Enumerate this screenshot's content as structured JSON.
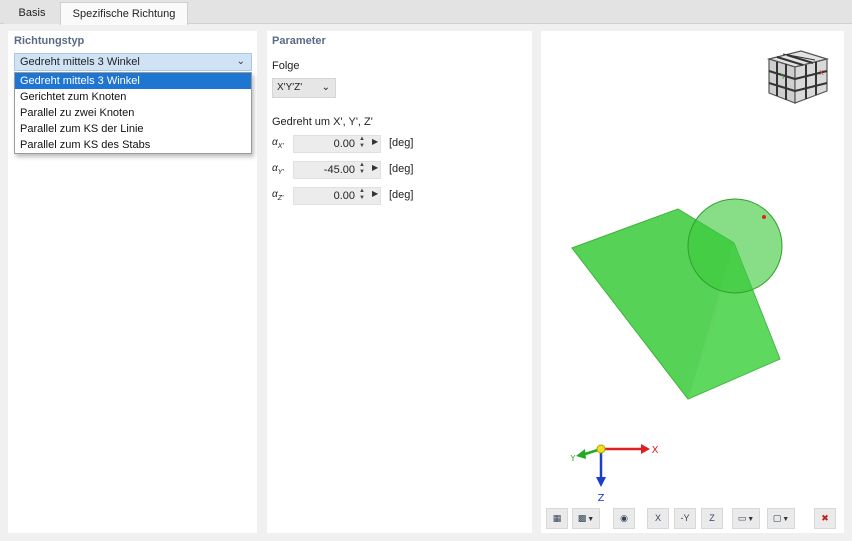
{
  "tabs": [
    {
      "label": "Basis"
    },
    {
      "label": "Spezifische Richtung"
    }
  ],
  "left_panel": {
    "title": "Richtungstyp",
    "selected": "Gedreht mittels 3 Winkel",
    "options": [
      "Gedreht mittels 3 Winkel",
      "Gerichtet zum Knoten",
      "Parallel zu zwei Knoten",
      "Parallel zum KS der Linie",
      "Parallel zum KS des Stabs"
    ]
  },
  "parameter": {
    "title": "Parameter",
    "folge_label": "Folge",
    "folge_value": "X'Y'Z'",
    "rotated_label": "Gedreht um X', Y', Z'",
    "rows": [
      {
        "sym": "α",
        "sub": "X'",
        "value": "0.00",
        "unit": "[deg]"
      },
      {
        "sym": "α",
        "sub": "Y'",
        "value": "-45.00",
        "unit": "[deg]"
      },
      {
        "sym": "α",
        "sub": "Z'",
        "value": "0.00",
        "unit": "[deg]"
      }
    ]
  },
  "viewer": {
    "axis_labels": {
      "x": "X",
      "y": "Y",
      "z": "Z"
    },
    "toolbar": [
      {
        "icon": "display-options-icon",
        "label": ""
      },
      {
        "icon": "render-mode-icon",
        "label": ""
      },
      {
        "icon": "visibility-icon",
        "label": ""
      },
      {
        "icon": "view-x-icon",
        "label": "X"
      },
      {
        "icon": "view-minus-y-icon",
        "label": "-Y"
      },
      {
        "icon": "view-z-icon",
        "label": "Z"
      },
      {
        "icon": "view-iso-icon",
        "label": ""
      },
      {
        "icon": "view-cube-icon",
        "label": ""
      },
      {
        "icon": "reset-view-icon",
        "label": ""
      }
    ]
  },
  "colors": {
    "accent": "#1f76d2",
    "solid_green": "#3ec93e",
    "section_title": "#5a6a85"
  }
}
